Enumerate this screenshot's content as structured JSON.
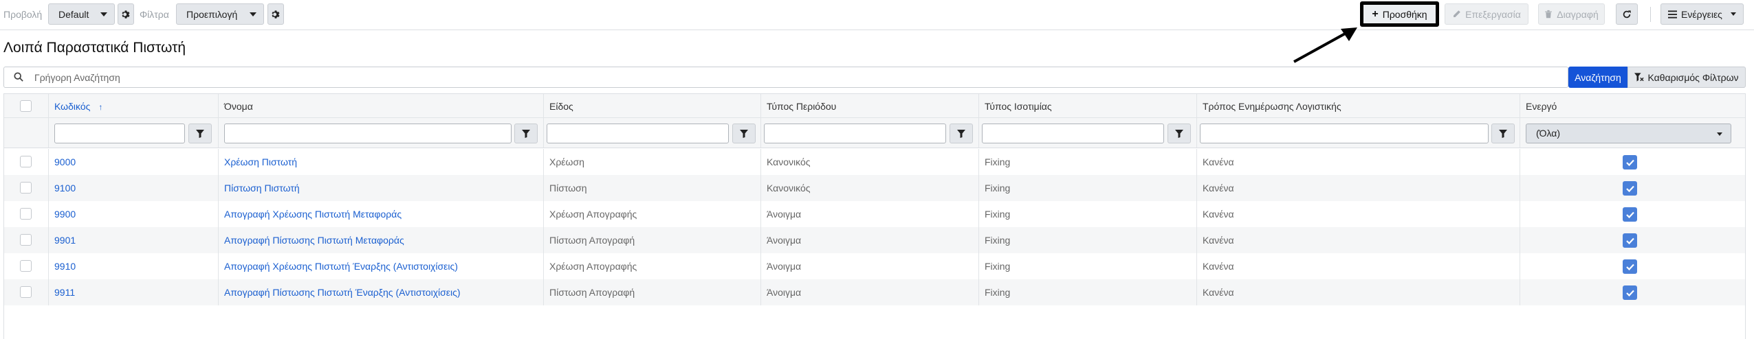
{
  "toolbar": {
    "view_label": "Προβολή",
    "view_value": "Default",
    "filter_label": "Φίλτρα",
    "filter_value": "Προεπιλογή",
    "add_label": "Προσθήκη",
    "edit_label": "Επεξεργασία",
    "delete_label": "Διαγραφή",
    "actions_label": "Ενέργειες"
  },
  "page": {
    "title": "Λοιπά Παραστατικά Πιστωτή"
  },
  "search": {
    "placeholder": "Γρήγορη Αναζήτηση",
    "search_button": "Αναζήτηση",
    "clear_button": "Καθαρισμός Φίλτρων"
  },
  "grid": {
    "columns": {
      "code": "Κωδικός",
      "name": "Όνομα",
      "kind": "Είδος",
      "period_type": "Τύπος Περιόδου",
      "parity_type": "Τύπος Ισοτιμίας",
      "accounting_mode": "Τρόπος Ενημέρωσης Λογιστικής",
      "active": "Ενεργό"
    },
    "active_filter_value": "(Όλα)",
    "rows": [
      {
        "code": "9000",
        "name": "Χρέωση Πιστωτή",
        "kind": "Χρέωση",
        "period_type": "Κανονικός",
        "parity_type": "Fixing",
        "accounting_mode": "Κανένα",
        "active": true
      },
      {
        "code": "9100",
        "name": "Πίστωση Πιστωτή",
        "kind": "Πίστωση",
        "period_type": "Κανονικός",
        "parity_type": "Fixing",
        "accounting_mode": "Κανένα",
        "active": true
      },
      {
        "code": "9900",
        "name": "Απογραφή Χρέωσης Πιστωτή Μεταφοράς",
        "kind": "Χρέωση Απογραφής",
        "period_type": "Άνοιγμα",
        "parity_type": "Fixing",
        "accounting_mode": "Κανένα",
        "active": true
      },
      {
        "code": "9901",
        "name": "Απογραφή Πίστωσης Πιστωτή Μεταφοράς",
        "kind": "Πίστωση Απογραφή",
        "period_type": "Άνοιγμα",
        "parity_type": "Fixing",
        "accounting_mode": "Κανένα",
        "active": true
      },
      {
        "code": "9910",
        "name": "Απογραφή Χρέωσης Πιστωτή Έναρξης (Αντιστοιχίσεις)",
        "kind": "Χρέωση Απογραφής",
        "period_type": "Άνοιγμα",
        "parity_type": "Fixing",
        "accounting_mode": "Κανένα",
        "active": true
      },
      {
        "code": "9911",
        "name": "Απογραφή Πίστωσης Πιστωτή Έναρξης (Αντιστοιχίσεις)",
        "kind": "Πίστωση Απογραφή",
        "period_type": "Άνοιγμα",
        "parity_type": "Fixing",
        "accounting_mode": "Κανένα",
        "active": true
      }
    ]
  },
  "icons": {
    "gear": "gear-icon",
    "plus": "plus-icon",
    "pencil": "pencil-icon",
    "trash": "trash-icon",
    "refresh": "refresh-icon",
    "menu": "menu-icon",
    "search": "search-icon",
    "filter": "filter-icon",
    "filter_clear": "filter-clear-icon",
    "check": "check-icon"
  },
  "colors": {
    "accent": "#1554d8",
    "link": "#1a5fd0",
    "checkbox_checked": "#4a80d9"
  }
}
